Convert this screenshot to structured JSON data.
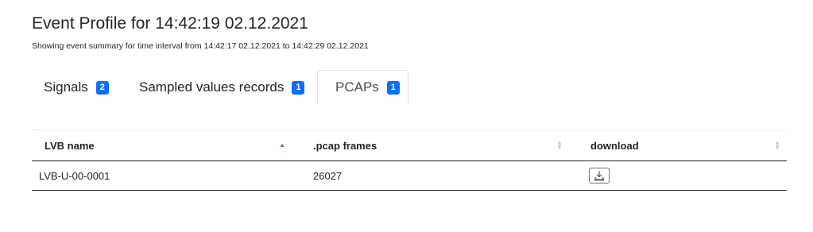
{
  "header": {
    "title": "Event Profile for 14:42:19 02.12.2021",
    "subtitle": "Showing event summary for time interval from 14:42:17 02.12.2021 to 14:42:29 02.12.2021"
  },
  "tabs": [
    {
      "label": "Signals",
      "count": "2",
      "active": false
    },
    {
      "label": "Sampled values records",
      "count": "1",
      "active": false
    },
    {
      "label": "PCAPs",
      "count": "1",
      "active": true
    }
  ],
  "table": {
    "columns": [
      "LVB name",
      ".pcap frames",
      "download"
    ],
    "sorted_column": "LVB name",
    "sort_direction": "ascending",
    "rows": [
      {
        "lvb_name": "LVB-U-00-0001",
        "pcap_frames": "26027",
        "download_icon": "download-icon"
      }
    ]
  },
  "colors": {
    "badge": "#0d6efd",
    "sort_active": "#5b6bd1",
    "text": "#212529"
  }
}
